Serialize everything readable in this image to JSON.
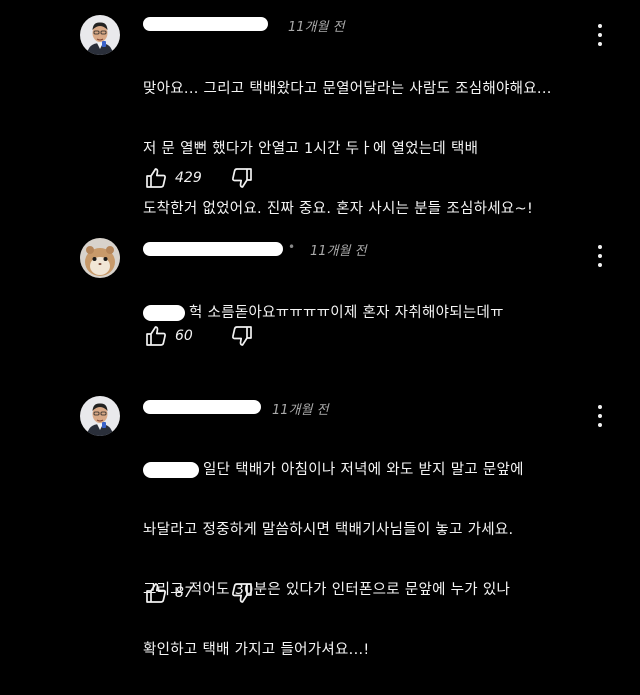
{
  "comments": [
    {
      "time": "11개월 전",
      "lines": [
        "맞아요... 그리고 택배왔다고 문열어달라는 사람도 조심해야해요...",
        "저 문 열뻔 했다가 안열고 1시간 두ㅏ에 열었는데 택배",
        "도착한거 없었어요. 진짜 중요. 혼자 사시는 분들 조심하세요~!"
      ],
      "likes": "429",
      "like_icon": "thumbs-up-icon",
      "dislike_icon": "thumbs-down-icon"
    },
    {
      "time": "11개월 전",
      "separator": "•",
      "lines": [
        "헉 소름돋아요ㅠㅠㅠㅠ이제 혼자 자취해야되는데ㅠ"
      ],
      "likes": "60",
      "like_icon": "thumbs-up-icon",
      "dislike_icon": "thumbs-down-icon"
    },
    {
      "time": "11개월 전",
      "lines": [
        "일단 택배가 아침이나 저녁에 와도 받지 말고 문앞에",
        "놔달라고 정중하게 말씀하시면 택배기사님들이 놓고 가세요.",
        "그리고 적어도 30분은 있다가 인터폰으로 문앞에 누가 있나",
        "확인하고 택배 가지고 들어가셔요...!"
      ],
      "likes": "87",
      "like_icon": "thumbs-up-icon",
      "dislike_icon": "thumbs-down-icon"
    }
  ]
}
